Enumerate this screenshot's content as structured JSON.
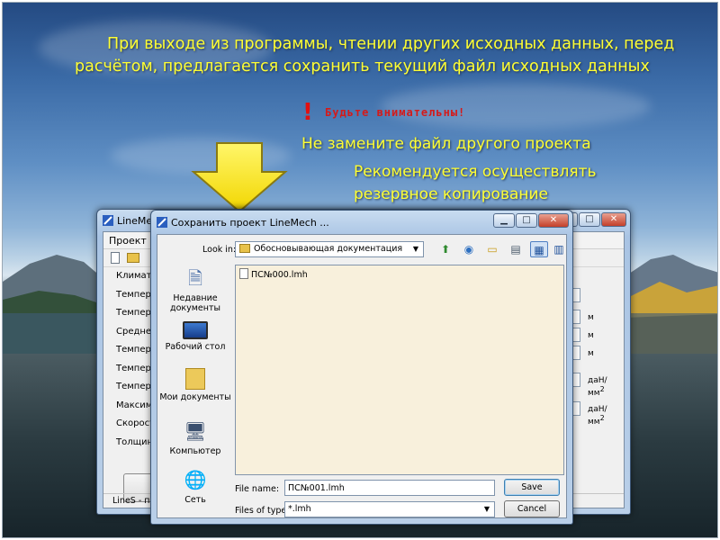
{
  "slide": {
    "title_line1": "При выходе из программы, чтении других исходных данных, перед",
    "title_line2": "расчётом, предлагается сохранить текущий файл исходных данных",
    "warning_mark": "!",
    "warning_caption": "Будьте внимательны!",
    "warning_line1": "Не замените файл другого проекта",
    "warning_line2": "Рекомендуется осуществлять",
    "warning_line3": "резервное копирование",
    "text_color": "#ffff33",
    "warning_color": "#d41a1a"
  },
  "background_window": {
    "title": "LineMech",
    "menu_project": "Проект",
    "rows": [
      {
        "label": "Климати"
      },
      {
        "label": "Температ"
      },
      {
        "label": "Температ"
      },
      {
        "label": "Среднего"
      },
      {
        "label": "Температ"
      },
      {
        "label": "Температ"
      },
      {
        "label": "Температ"
      },
      {
        "label": "Максима"
      },
      {
        "label": "Скорость"
      },
      {
        "label": "Толщина"
      }
    ],
    "units": [
      "м",
      "м",
      "м",
      "даН/мм",
      "даН/мм"
    ],
    "unit_superscript": "2",
    "status": "LineS - пр"
  },
  "dialog": {
    "title": "Сохранить проект LineMech ...",
    "look_in_label": "Look in:",
    "look_in_value": "Обосновывающая документация",
    "places": [
      {
        "label_line1": "Недавние",
        "label_line2": "документы",
        "icon": "recent-documents-icon"
      },
      {
        "label_line1": "Рабочий стол",
        "label_line2": "",
        "icon": "desktop-icon"
      },
      {
        "label_line1": "Мои документы",
        "label_line2": "",
        "icon": "my-documents-icon"
      },
      {
        "label_line1": "Компьютер",
        "label_line2": "",
        "icon": "computer-icon"
      },
      {
        "label_line1": "Сеть",
        "label_line2": "",
        "icon": "network-icon"
      }
    ],
    "files": [
      {
        "name": "ПС№000.lmh"
      }
    ],
    "file_name_label": "File name:",
    "file_name_value": "ПС№001.lmh",
    "file_type_label": "Files of type:",
    "file_type_value": "*.lmh",
    "save_button": "Save",
    "cancel_button": "Cancel"
  }
}
